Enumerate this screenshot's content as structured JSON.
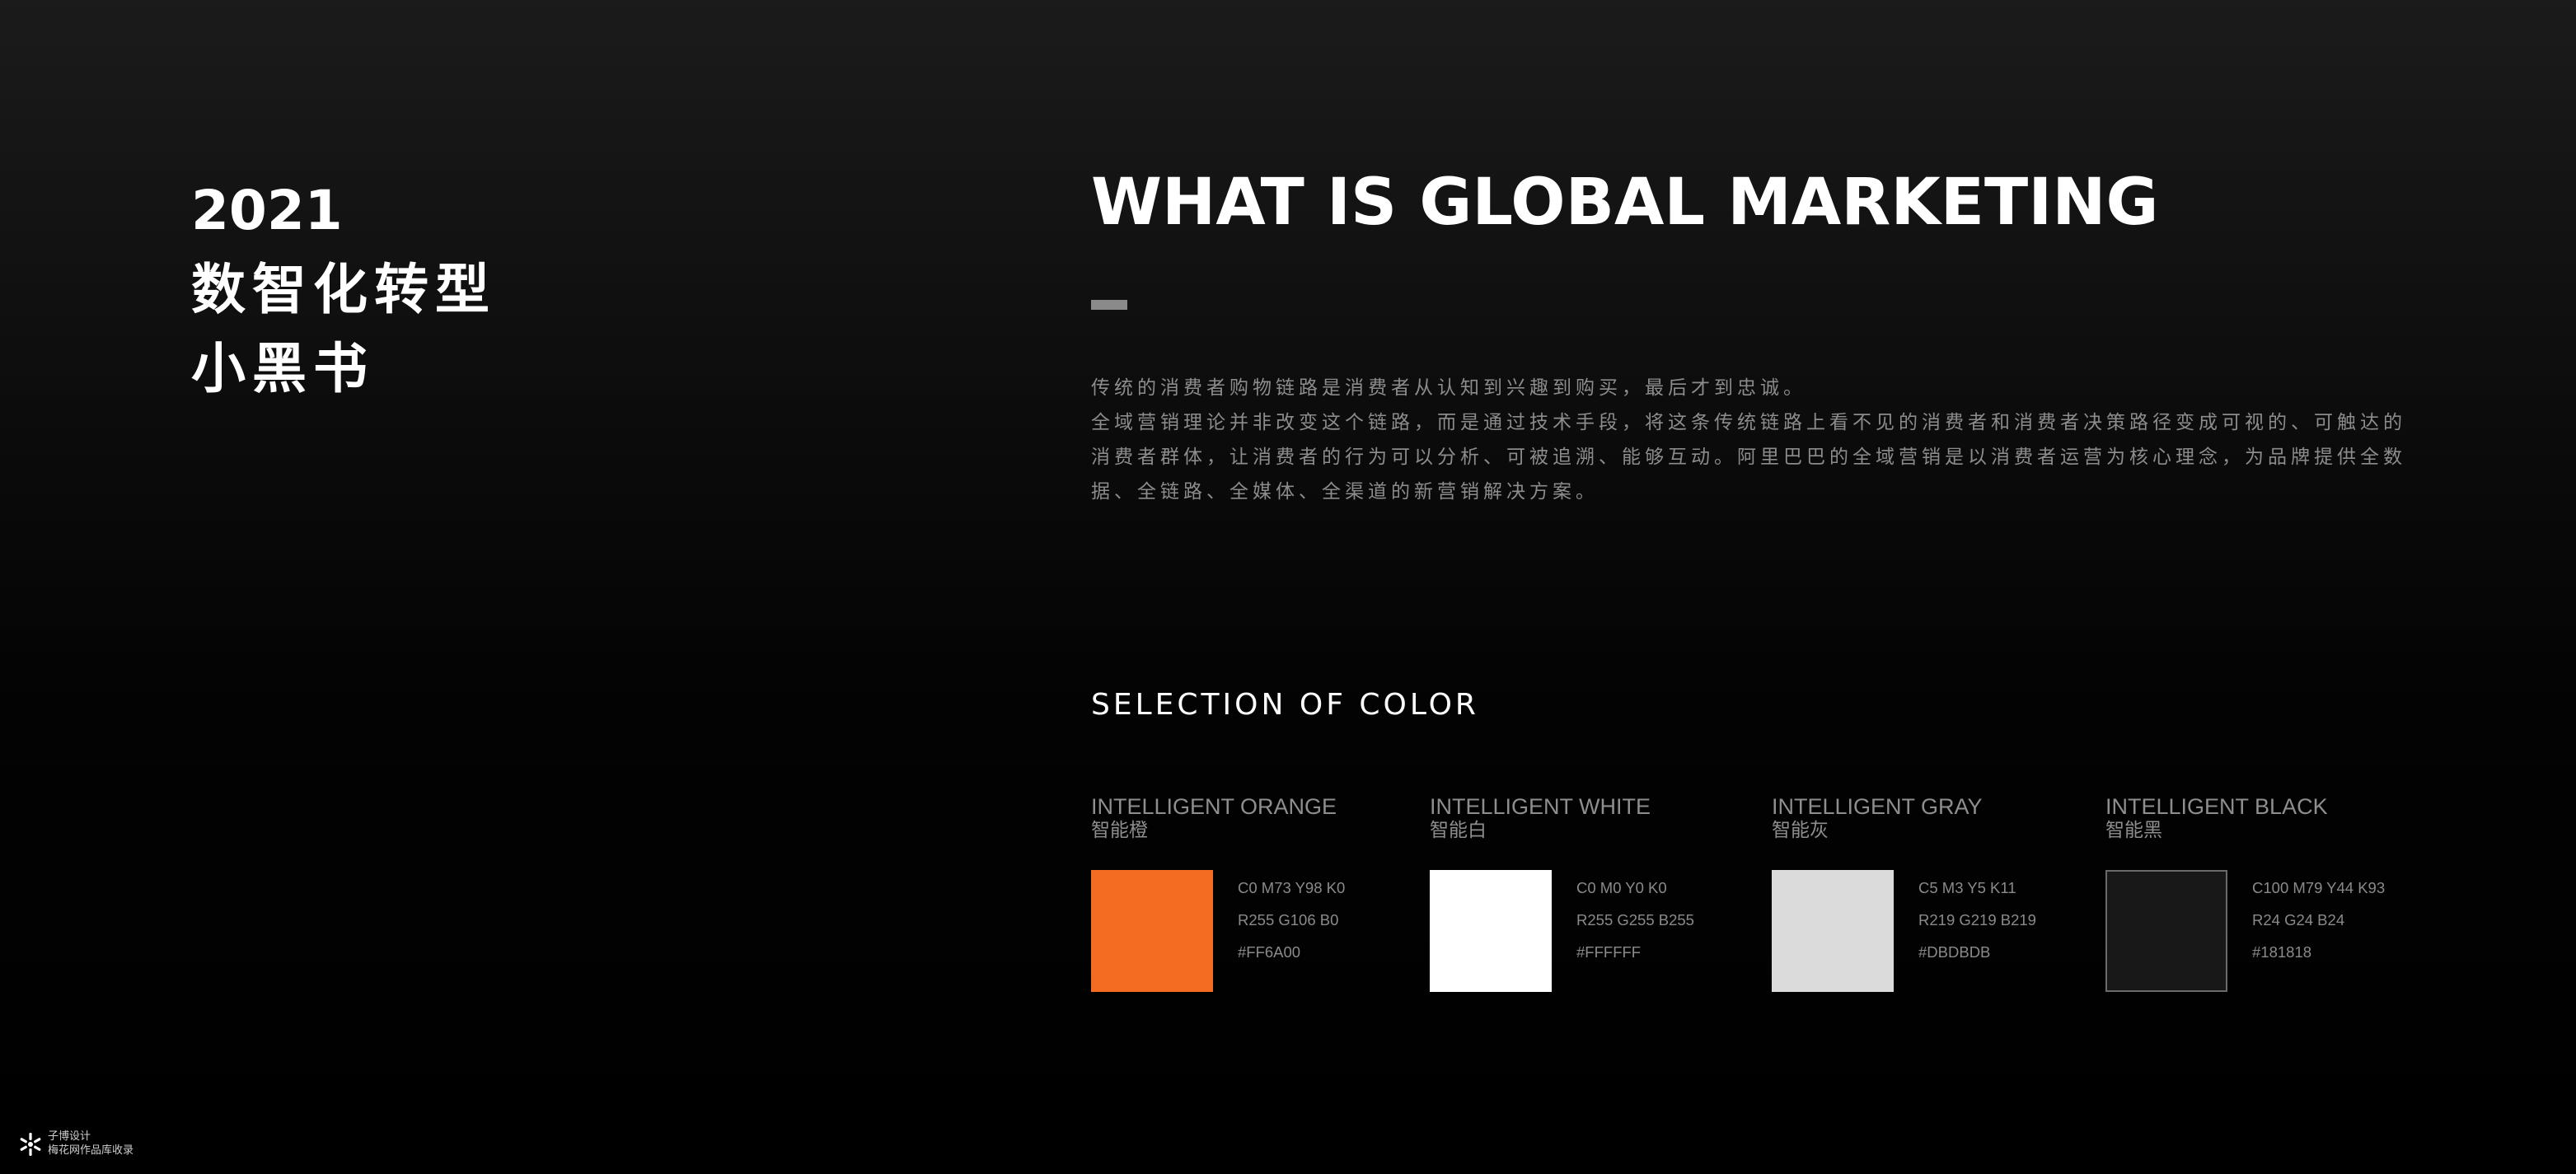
{
  "cover": {
    "year": "2021",
    "title_line1": "数智化转型",
    "title_line2": "小黑书"
  },
  "heading": "WHAT IS GLOBAL MARKETING",
  "intro": {
    "paragraph1": "传统的消费者购物链路是消费者从认知到兴趣到购买，最后才到忠诚。",
    "paragraph2": "全域营销理论并非改变这个链路，而是通过技术手段，将这条传统链路上看不见的消费者和消费者决策路径变成可视的、可触达的消费者群体，让消费者的行为可以分析、可被追溯、能够互动。阿里巴巴的全域营销是以消费者运营为核心理念，为品牌提供全数据、全链路、全媒体、全渠道的新营销解决方案。"
  },
  "colors": {
    "title": "SELECTION OF COLOR",
    "swatches": [
      {
        "name": "INTELLIGENT ORANGE",
        "name_cn": "智能橙",
        "cmyk": "C0 M73 Y98 K0",
        "rgb": "R255 G106 B0",
        "hex_label": "#FF6A00",
        "color": "#f46b22",
        "outlined": false
      },
      {
        "name": "INTELLIGENT  WHITE",
        "name_cn": "智能白",
        "cmyk": "C0 M0 Y0 K0",
        "rgb": "R255 G255 B255",
        "hex_label": "#FFFFFF",
        "color": "#ffffff",
        "outlined": false
      },
      {
        "name": "INTELLIGENT GRAY",
        "name_cn": "智能灰",
        "cmyk": "C5 M3 Y5 K11",
        "rgb": "R219 G219 B219",
        "hex_label": "#DBDBDB",
        "color": "#dbdbdb",
        "outlined": false
      },
      {
        "name": "INTELLIGENT  BLACK",
        "name_cn": "智能黑",
        "cmyk": "C100 M79 Y44 K93",
        "rgb": "R24 G24 B24",
        "hex_label": "#181818",
        "color": "#181818",
        "outlined": true
      }
    ]
  },
  "footer": {
    "logo_icon": "snowflake-logo-icon",
    "brand": "子博设计",
    "note": "梅花网作品库收录"
  }
}
